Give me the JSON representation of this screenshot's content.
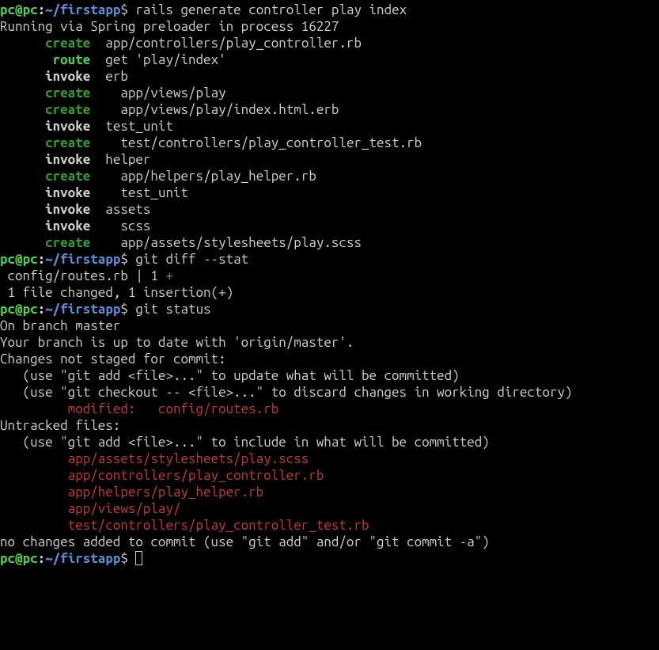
{
  "prompt": {
    "user": "pc",
    "at": "@",
    "host": "pc",
    "colon": ":",
    "path": "~/firstapp",
    "dollar": "$ "
  },
  "commands": {
    "c1": "rails generate controller play index",
    "c2": "git diff --stat",
    "c3": "git status",
    "c4": ""
  },
  "rails": {
    "running": "Running via Spring preloader in process 16227",
    "k_create": "create",
    "k_route": "route",
    "k_invoke": "invoke",
    "p1": "app/controllers/play_controller.rb",
    "p2": "get 'play/index'",
    "p3": "erb",
    "p4": "app/views/play",
    "p5": "app/views/play/index.html.erb",
    "p6": "test_unit",
    "p7": "test/controllers/play_controller_test.rb",
    "p8": "helper",
    "p9": "app/helpers/play_helper.rb",
    "p10": "test_unit",
    "p11": "assets",
    "p12": "scss",
    "p13": "app/assets/stylesheets/play.scss",
    "pad6": "      ",
    "pad7": "       ",
    "post2": "  ",
    "post4": "    "
  },
  "diff": {
    "l1_a": " config/routes.rb | 1 ",
    "l1_plus": "+",
    "l2": " 1 file changed, 1 insertion(+)"
  },
  "status": {
    "l1": "On branch master",
    "l2": "Your branch is up to date with 'origin/master'.",
    "blank": "",
    "l3": "Changes not staged for commit:",
    "l4": "   (use \"git add <file>...\" to update what will be committed)",
    "l5": "   (use \"git checkout -- <file>...\" to discard changes in working directory)",
    "modpad": "         ",
    "mod1": "modified:   config/routes.rb",
    "l6": "Untracked files:",
    "l7": "   (use \"git add <file>...\" to include in what will be committed)",
    "untpad": "         ",
    "u1": "app/assets/stylesheets/play.scss",
    "u2": "app/controllers/play_controller.rb",
    "u3": "app/helpers/play_helper.rb",
    "u4": "app/views/play/",
    "u5": "test/controllers/play_controller_test.rb",
    "l8": "no changes added to commit (use \"git add\" and/or \"git commit -a\")"
  }
}
